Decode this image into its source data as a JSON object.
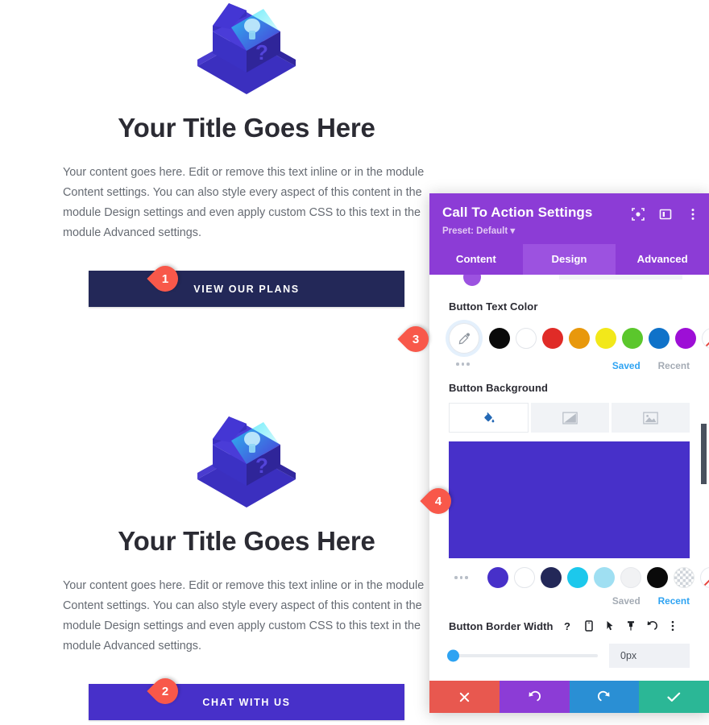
{
  "page": {
    "blocks": [
      {
        "title": "Your Title Goes Here",
        "body": "Your content goes here. Edit or remove this text inline or in the module Content settings. You can also style every aspect of this content in the module Design settings and even apply custom CSS to this text in the module Advanced settings.",
        "button_label": "VIEW OUR PLANS",
        "button_color": "#232858",
        "marker": "1"
      },
      {
        "title": "Your Title Goes Here",
        "body": "Your content goes here. Edit or remove this text inline or in the module Content settings. You can also style every aspect of this content in the module Design settings and even apply custom CSS to this text in the module Advanced settings.",
        "button_label": "CHAT WITH US",
        "button_color": "#4730c9",
        "marker": "2"
      }
    ],
    "illustration_name": "isometric-box-lightbulb-question-mark"
  },
  "panel": {
    "title": "Call To Action Settings",
    "preset": "Preset: Default",
    "preset_caret": "▾",
    "header_icons": [
      {
        "name": "focus-target-icon"
      },
      {
        "name": "layout-split-icon"
      },
      {
        "name": "kebab-menu-icon"
      }
    ],
    "tabs": [
      {
        "label": "Content",
        "active": false
      },
      {
        "label": "Design",
        "active": true
      },
      {
        "label": "Advanced",
        "active": false
      }
    ],
    "marker_text_color": "3",
    "marker_background": "4",
    "text_color": {
      "label": "Button Text Color",
      "picker_icon": "eyedropper-icon",
      "more_dots": "more-colors-icon",
      "swatches": [
        {
          "name": "black",
          "hex": "#0a0a0a"
        },
        {
          "name": "white",
          "hex": "#ffffff"
        },
        {
          "name": "red",
          "hex": "#e02b27"
        },
        {
          "name": "orange",
          "hex": "#e8980c"
        },
        {
          "name": "yellow",
          "hex": "#f2e81a"
        },
        {
          "name": "green",
          "hex": "#5bc72c"
        },
        {
          "name": "blue",
          "hex": "#0f72c9"
        },
        {
          "name": "purple",
          "hex": "#9d0fd6"
        },
        {
          "name": "transparent",
          "hex": "transparent"
        }
      ],
      "saved_label": "Saved",
      "recent_label": "Recent",
      "active_tab": "Saved"
    },
    "background": {
      "label": "Button Background",
      "tabs": [
        {
          "name": "background-color-tab",
          "icon": "paint-bucket-icon",
          "active": true
        },
        {
          "name": "background-gradient-tab",
          "icon": "gradient-icon",
          "active": false
        },
        {
          "name": "background-image-tab",
          "icon": "image-icon",
          "active": false
        }
      ],
      "preview_color": "#4730c9",
      "more_dots": "more-colors-icon",
      "swatches": [
        {
          "name": "purple",
          "hex": "#4730c9"
        },
        {
          "name": "white",
          "hex": "#ffffff"
        },
        {
          "name": "navy",
          "hex": "#232858"
        },
        {
          "name": "cyan",
          "hex": "#1cc8ec"
        },
        {
          "name": "light-blue",
          "hex": "#9fdff2"
        },
        {
          "name": "off-white",
          "hex": "#f1f2f4"
        },
        {
          "name": "black",
          "hex": "#0a0a0a"
        },
        {
          "name": "checkered",
          "hex": "checker"
        },
        {
          "name": "transparent",
          "hex": "transparent"
        }
      ],
      "saved_label": "Saved",
      "recent_label": "Recent",
      "active_tab": "Recent"
    },
    "border_width": {
      "label": "Button Border Width",
      "value": "0px",
      "slider_percent": 0,
      "icons": [
        {
          "name": "help-icon"
        },
        {
          "name": "responsive-device-icon"
        },
        {
          "name": "hover-cursor-icon"
        },
        {
          "name": "sticky-pin-icon"
        },
        {
          "name": "reset-undo-icon"
        },
        {
          "name": "kebab-menu-icon"
        }
      ]
    },
    "footer_buttons": [
      {
        "name": "close-button",
        "icon": "close-x-icon",
        "color": "#e8584f"
      },
      {
        "name": "undo-button",
        "icon": "undo-icon",
        "color": "#8c3cd6"
      },
      {
        "name": "redo-button",
        "icon": "redo-icon",
        "color": "#2a8fd4"
      },
      {
        "name": "save-button",
        "icon": "checkmark-icon",
        "color": "#2bb796"
      }
    ],
    "scrollbar": {
      "name": "panel-scrollbar"
    }
  }
}
